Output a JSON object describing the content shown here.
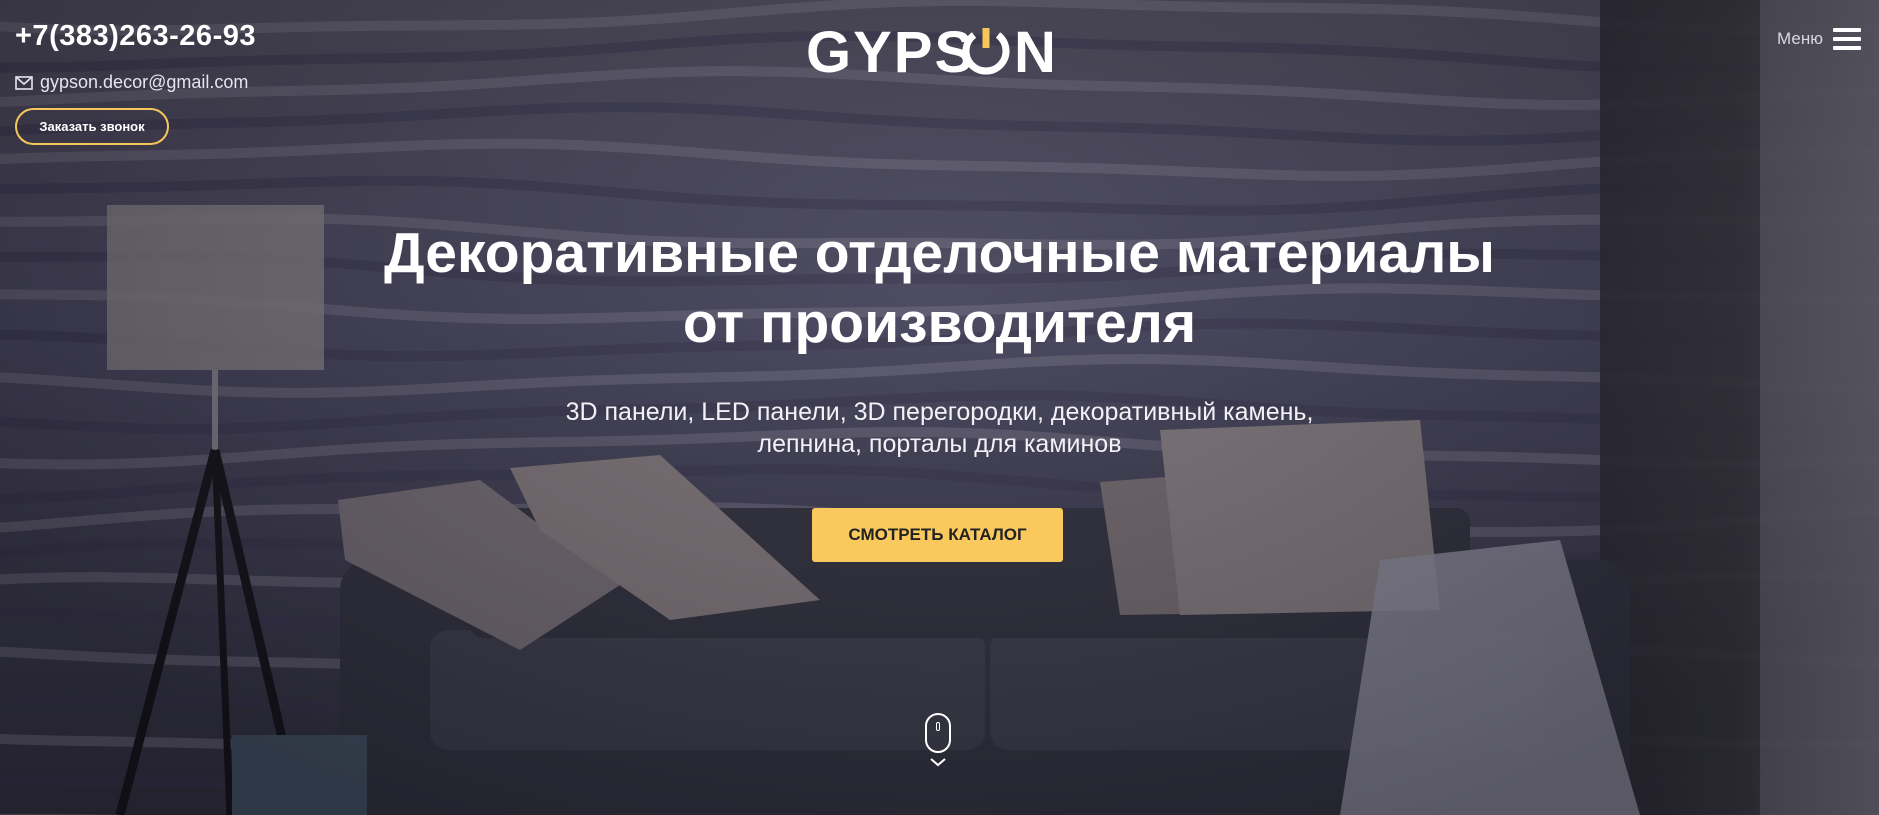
{
  "header": {
    "phone": "+7(383)263-26-93",
    "email": "gypson.decor@gmail.com",
    "callback_label": "Заказать звонок",
    "logo": "GYPSON",
    "menu_label": "Меню"
  },
  "hero": {
    "title_line1": "Декоративные отделочные материалы",
    "title_line2": "от производителя",
    "subtitle_line1": "3D панели, LED панели, 3D перегородки, декоративный камень,",
    "subtitle_line2": "лепнина, порталы для каминов",
    "cta_label": "СМОТРЕТЬ КАТАЛОГ"
  },
  "colors": {
    "accent": "#fac95e",
    "button_border": "#f6c65b"
  },
  "icons": {
    "email": "envelope-icon",
    "menu": "hamburger-icon",
    "scroll": "mouse-icon",
    "scroll_arrow": "chevron-down-icon"
  }
}
